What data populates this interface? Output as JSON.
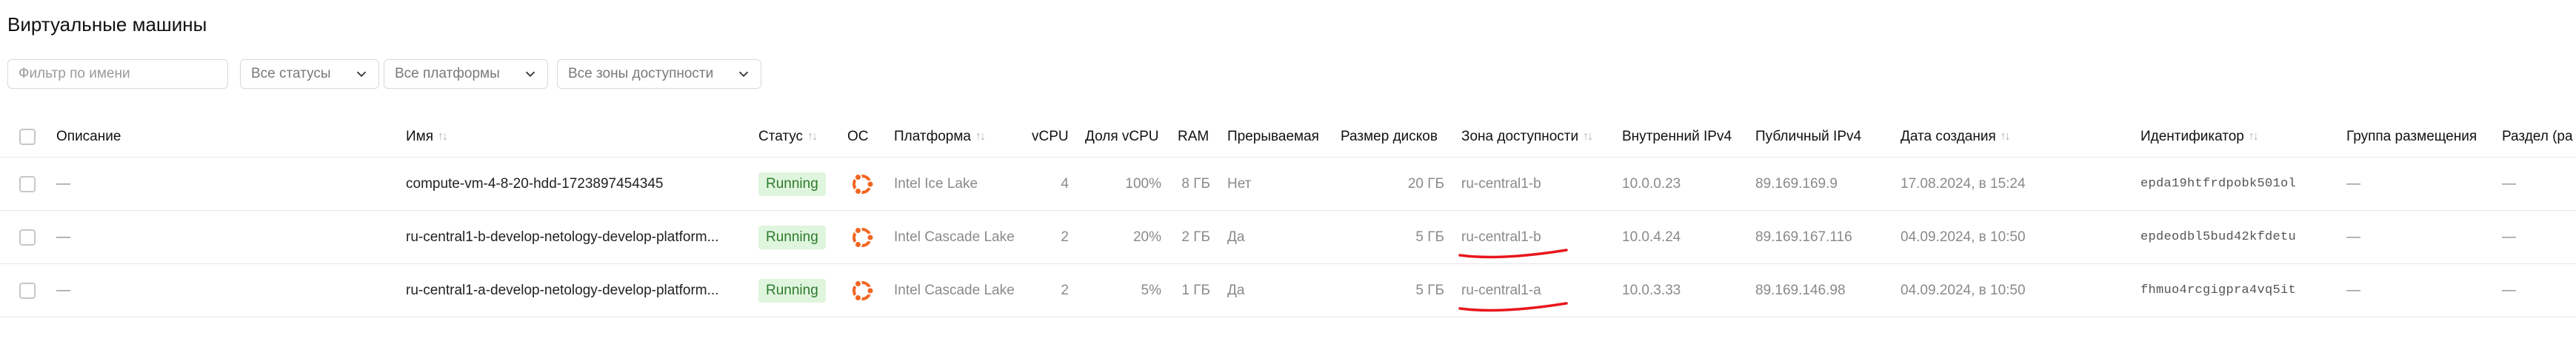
{
  "page": {
    "title": "Виртуальные машины"
  },
  "filters": {
    "name_placeholder": "Фильтр по имени",
    "status_select": "Все статусы",
    "platform_select": "Все платформы",
    "zone_select": "Все зоны доступности"
  },
  "table": {
    "headers": {
      "description": "Описание",
      "name": "Имя",
      "status": "Статус",
      "os": "ОС",
      "platform": "Платформа",
      "vcpu": "vCPU",
      "vcpu_share": "Доля vCPU",
      "ram": "RAM",
      "preemptible": "Прерываемая",
      "disk_size": "Размер дисков",
      "zone": "Зона доступности",
      "internal_ipv4": "Внутренний IPv4",
      "public_ipv4": "Публичный IPv4",
      "created": "Дата создания",
      "id": "Идентификатор",
      "placement_group": "Группа размещения",
      "partition": "Раздел (ра"
    },
    "sort_glyph": "↑↓",
    "rows": [
      {
        "description": "—",
        "name": "compute-vm-4-8-20-hdd-1723897454345",
        "status": "Running",
        "os_icon": "ubuntu-icon",
        "platform": "Intel Ice Lake",
        "vcpu": "4",
        "vcpu_share": "100%",
        "ram": "8 ГБ",
        "preemptible": "Нет",
        "disk_size": "20 ГБ",
        "zone": "ru-central1-b",
        "internal_ipv4": "10.0.0.23",
        "public_ipv4": "89.169.169.9",
        "created": "17.08.2024, в 15:24",
        "id": "epda19htfrdpobk501ol",
        "placement_group": "—",
        "partition": "—"
      },
      {
        "description": "—",
        "name": "ru-central1-b-develop-netology-develop-platform...",
        "status": "Running",
        "os_icon": "ubuntu-icon",
        "platform": "Intel Cascade Lake",
        "vcpu": "2",
        "vcpu_share": "20%",
        "ram": "2 ГБ",
        "preemptible": "Да",
        "disk_size": "5 ГБ",
        "zone": "ru-central1-b",
        "internal_ipv4": "10.0.4.24",
        "public_ipv4": "89.169.167.116",
        "created": "04.09.2024, в 10:50",
        "id": "epdeodbl5bud42kfdetu",
        "placement_group": "—",
        "partition": "—"
      },
      {
        "description": "—",
        "name": "ru-central1-a-develop-netology-develop-platform...",
        "status": "Running",
        "os_icon": "ubuntu-icon",
        "platform": "Intel Cascade Lake",
        "vcpu": "2",
        "vcpu_share": "5%",
        "ram": "1 ГБ",
        "preemptible": "Да",
        "disk_size": "5 ГБ",
        "zone": "ru-central1-a",
        "internal_ipv4": "10.0.3.33",
        "public_ipv4": "89.169.146.98",
        "created": "04.09.2024, в 10:50",
        "id": "fhmuo4rcgigpra4vq5it",
        "placement_group": "—",
        "partition": "—"
      }
    ]
  },
  "colors": {
    "status_running_bg": "#dff5dd",
    "status_running_text": "#2d7a2d",
    "os_icon": "#f26522",
    "annotation_underline": "#e8171c"
  }
}
